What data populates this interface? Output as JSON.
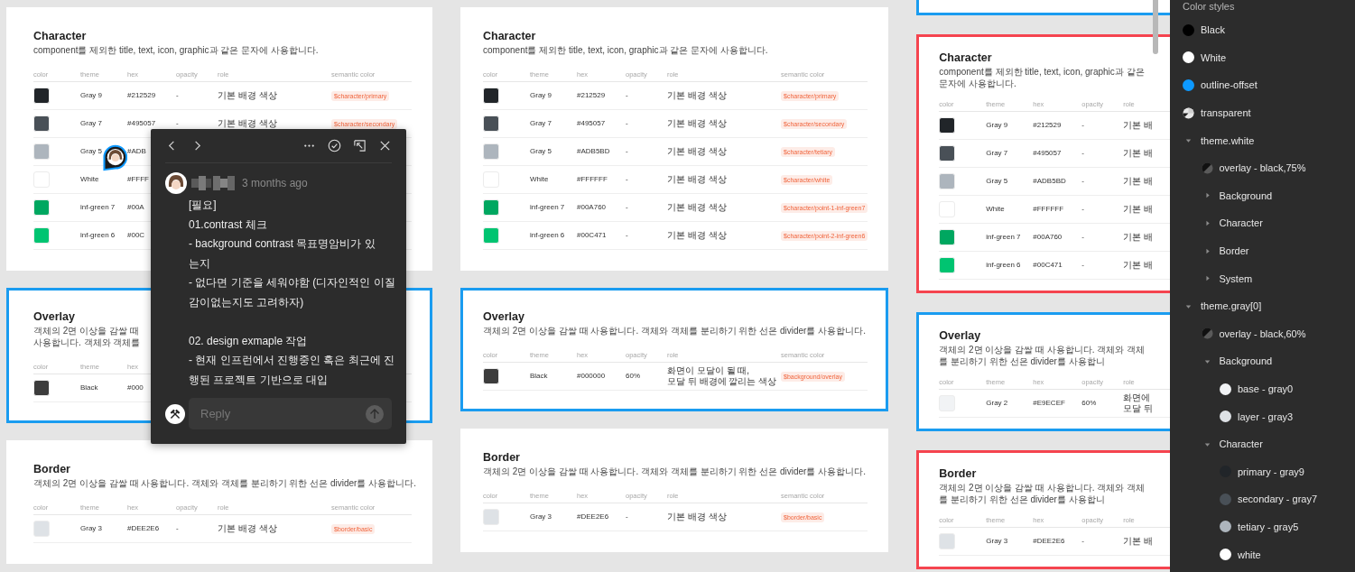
{
  "canvas": {
    "columns": [
      {
        "frames": [
          {
            "title": "Character",
            "description": "component를 제외한 title, text, icon, graphic과 같은 문자에 사용합니다.",
            "headers": [
              "color",
              "theme",
              "hex",
              "opacity",
              "role",
              "semantic color"
            ],
            "rows": [
              {
                "color": "#212529",
                "theme": "Gray 9",
                "hex": "#212529",
                "opacity": "-",
                "role": "기본 배경 색상",
                "semantic": "$character/primary"
              },
              {
                "color": "#495057",
                "theme": "Gray 7",
                "hex": "#495057",
                "opacity": "-",
                "role": "기본 배경 색상",
                "semantic": "$character/secondary"
              },
              {
                "color": "#adb5bd",
                "theme": "Gray 5",
                "hex": "#ADB"
              },
              {
                "color": "#ffffff",
                "theme": "White",
                "hex": "#FFFF"
              },
              {
                "color": "#00a760",
                "theme": "inf-green 7",
                "hex": "#00A"
              },
              {
                "color": "#00c471",
                "theme": "inf-green 6",
                "hex": "#00C"
              }
            ]
          },
          {
            "title": "Overlay",
            "color": "#1a9cf0",
            "description": "객체의 2면 이상을 감쌀 때 사용합니다. 객체와 객체를",
            "headers": [
              "color",
              "theme",
              "hex"
            ],
            "rows": [
              {
                "color": "#3c3c3c",
                "theme": "Black",
                "hex": "#000"
              }
            ]
          },
          {
            "title": "Border",
            "description": "객체의 2면 이상을 감쌀 때 사용합니다. 객체와 객체를 분리하기 위한 선은 divider를 사용합니다.",
            "headers": [
              "color",
              "theme",
              "hex",
              "opacity",
              "role",
              "semantic color"
            ],
            "rows": [
              {
                "color": "#dee2e6",
                "theme": "Gray 3",
                "hex": "#DEE2E6",
                "opacity": "-",
                "role": "기본 배경 색상",
                "semantic": "$border/basic"
              }
            ]
          }
        ]
      },
      {
        "frames": [
          {
            "title": "Character",
            "description": "component를 제외한 title, text, icon, graphic과 같은 문자에 사용합니다.",
            "headers": [
              "color",
              "theme",
              "hex",
              "opacity",
              "role",
              "semantic color"
            ],
            "rows": [
              {
                "color": "#212529",
                "theme": "Gray 9",
                "hex": "#212529",
                "opacity": "-",
                "role": "기본 배경 색상",
                "semantic": "$character/primary"
              },
              {
                "color": "#495057",
                "theme": "Gray 7",
                "hex": "#495057",
                "opacity": "-",
                "role": "기본 배경 색상",
                "semantic": "$character/secondary"
              },
              {
                "color": "#adb5bd",
                "theme": "Gray 5",
                "hex": "#ADB5BD",
                "opacity": "-",
                "role": "기본 배경 색상",
                "semantic": "$character/tetiary"
              },
              {
                "color": "#ffffff",
                "theme": "White",
                "hex": "#FFFFFF",
                "opacity": "-",
                "role": "기본 배경 색상",
                "semantic": "$character/white"
              },
              {
                "color": "#00a760",
                "theme": "inf-green 7",
                "hex": "#00A760",
                "opacity": "-",
                "role": "기본 배경 색상",
                "semantic": "$character/point-1-inf-green7"
              },
              {
                "color": "#00c471",
                "theme": "inf-green 6",
                "hex": "#00C471",
                "opacity": "-",
                "role": "기본 배경 색상",
                "semantic": "$character/point-2-inf-green6"
              }
            ]
          },
          {
            "title": "Overlay",
            "color": "#1a9cf0",
            "description": "객체의 2면 이상을 감쌀 때 사용합니다. 객체와 객체를 분리하기 위한 선은 divider를 사용합니다.",
            "headers": [
              "color",
              "theme",
              "hex",
              "opacity",
              "role",
              "semantic color"
            ],
            "rows": [
              {
                "color": "#3c3c3c",
                "theme": "Black",
                "hex": "#000000",
                "opacity": "60%",
                "role": "화면이 모달이 될 때,\n모달 뒤 배경에 깔리는 색상",
                "semantic": "$background/overlay"
              }
            ]
          },
          {
            "title": "Border",
            "description": "객체의 2면 이상을 감쌀 때 사용합니다. 객체와 객체를 분리하기 위한 선은 divider를 사용합니다.",
            "headers": [
              "color",
              "theme",
              "hex",
              "opacity",
              "role",
              "semantic color"
            ],
            "rows": [
              {
                "color": "#dee2e6",
                "theme": "Gray 3",
                "hex": "#DEE2E6",
                "opacity": "-",
                "role": "기본 배경 색상",
                "semantic": "$border/basic"
              }
            ]
          }
        ]
      },
      {
        "frames": [
          {
            "color": "#1a9cf0"
          },
          {
            "title": "Character",
            "color": "#f5444f",
            "description": "component를 제외한 title, text, icon, graphic과 같은 문자에 사용합니다.",
            "headers": [
              "color",
              "theme",
              "hex",
              "opacity",
              "role"
            ],
            "rows": [
              {
                "color": "#212529",
                "theme": "Gray 9",
                "hex": "#212529",
                "opacity": "-",
                "role": "기본 배"
              },
              {
                "color": "#495057",
                "theme": "Gray 7",
                "hex": "#495057",
                "opacity": "-",
                "role": "기본 배"
              },
              {
                "color": "#adb5bd",
                "theme": "Gray 5",
                "hex": "#ADB5BD",
                "opacity": "-",
                "role": "기본 배"
              },
              {
                "color": "#ffffff",
                "theme": "White",
                "hex": "#FFFFFF",
                "opacity": "-",
                "role": "기본 배"
              },
              {
                "color": "#00a760",
                "theme": "inf-green 7",
                "hex": "#00A760",
                "opacity": "-",
                "role": "기본 배"
              },
              {
                "color": "#00c471",
                "theme": "inf-green 6",
                "hex": "#00C471",
                "opacity": "-",
                "role": "기본 배"
              }
            ]
          },
          {
            "title": "Overlay",
            "color": "#1a9cf0",
            "description": "객체의 2면 이상을 감쌀 때 사용합니다. 객체와 객체를 분리하기 위한 선은 divider를 사용합니",
            "headers": [
              "color",
              "theme",
              "hex",
              "opacity",
              "role"
            ],
            "rows": [
              {
                "color": "#f1f3f5",
                "theme": "Gray 2",
                "hex": "#E9ECEF",
                "opacity": "60%",
                "role": "화면에\n모달 뒤"
              }
            ]
          },
          {
            "title": "Border",
            "color": "#f5444f",
            "description": "객체의 2면 이상을 감쌀 때 사용합니다. 객체와 객체를 분리하기 위한 선은 divider를 사용합니",
            "headers": [
              "color",
              "theme",
              "hex",
              "opacity",
              "role"
            ],
            "rows": [
              {
                "color": "#dee2e6",
                "theme": "Gray 3",
                "hex": "#DEE2E6",
                "opacity": "-",
                "role": "기본 배"
              }
            ]
          }
        ]
      }
    ]
  },
  "comment": {
    "time": "3 months ago",
    "blocks": [
      [
        "[필요]",
        "01.contrast 체크",
        "- background contrast 목표명암비가 있",
        "는지",
        "- 없다면 기준을 세워야함 (디자인적인 이질",
        "감이없는지도 고려하자)"
      ],
      [
        "02. design exmaple 작업",
        "- 현재 인프런에서 진행중인 혹은 최근에 진",
        "행된 프로젝트 기반으로  대입"
      ]
    ],
    "reply": {
      "placeholder": "Reply"
    }
  },
  "color_styles": {
    "title": "Color styles",
    "items": [
      {
        "kind": "solid",
        "name": "Black",
        "color": "#000000"
      },
      {
        "kind": "solid",
        "name": "White",
        "color": "#ffffff"
      },
      {
        "kind": "solid",
        "name": "outline-offset",
        "color": "#0d99ff"
      },
      {
        "kind": "transparent",
        "name": "transparent"
      },
      {
        "kind": "group",
        "name": "theme.white",
        "expanded": true,
        "children": [
          {
            "kind": "overlay",
            "name": "overlay - black,75%"
          },
          {
            "kind": "group",
            "name": "Background",
            "expanded": false
          },
          {
            "kind": "group",
            "name": "Character",
            "expanded": false
          },
          {
            "kind": "group",
            "name": "Border",
            "expanded": false
          },
          {
            "kind": "group",
            "name": "System",
            "expanded": false
          }
        ]
      },
      {
        "kind": "group",
        "name": "theme.gray[0]",
        "expanded": true,
        "children": [
          {
            "kind": "overlay",
            "name": "overlay - black,60%"
          },
          {
            "kind": "group",
            "name": "Background",
            "expanded": true,
            "children": [
              {
                "kind": "solid",
                "name": "base - gray0",
                "color": "#f1f3f5"
              },
              {
                "kind": "solid",
                "name": "layer - gray3",
                "color": "#dee2e6"
              }
            ]
          },
          {
            "kind": "group",
            "name": "Character",
            "expanded": true,
            "children": [
              {
                "kind": "solid",
                "name": "primary - gray9",
                "color": "#212529"
              },
              {
                "kind": "solid",
                "name": "secondary - gray7",
                "color": "#495057"
              },
              {
                "kind": "solid",
                "name": "tetiary - gray5",
                "color": "#adb5bd"
              },
              {
                "kind": "solid",
                "name": "white",
                "color": "#ffffff"
              }
            ]
          }
        ]
      }
    ]
  }
}
